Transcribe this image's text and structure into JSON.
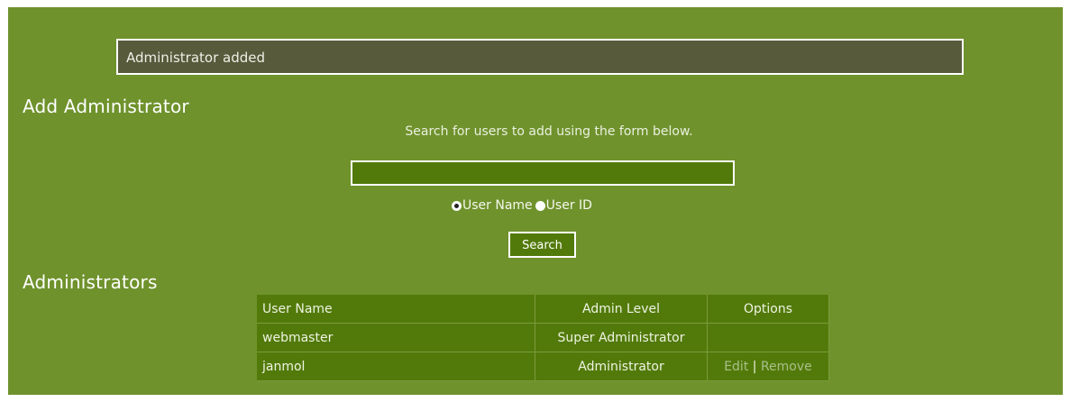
{
  "notice": {
    "text": "Administrator added"
  },
  "add_section": {
    "heading": "Add Administrator",
    "hint": "Search for users to add using the form below.",
    "search_value": "",
    "radio_options": [
      {
        "label": "User Name",
        "selected": true
      },
      {
        "label": "User ID",
        "selected": false
      }
    ],
    "search_button": "Search"
  },
  "admins_section": {
    "heading": "Administrators",
    "columns": [
      "User Name",
      "Admin Level",
      "Options"
    ],
    "rows": [
      {
        "user": "webmaster",
        "level": "Super Administrator",
        "edit": "",
        "sep": "",
        "remove": ""
      },
      {
        "user": "janmol",
        "level": "Administrator",
        "edit": "Edit",
        "sep": "|",
        "remove": "Remove"
      }
    ]
  }
}
